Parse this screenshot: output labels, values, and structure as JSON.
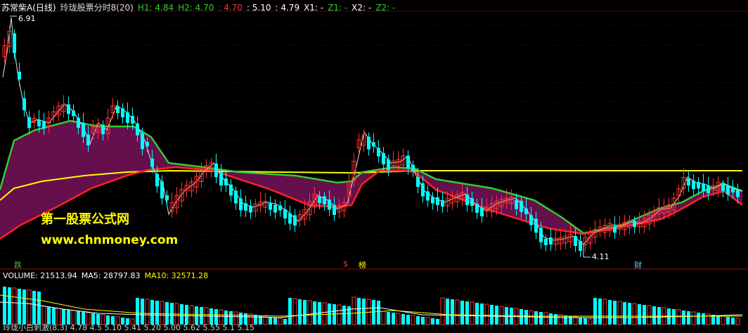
{
  "header": {
    "stock_name": "苏常柴A",
    "period": "(日线)",
    "indicator": "玲珑股票分时8(20)",
    "h1": "H1: 4.84",
    "h2": "H2: 4.70",
    "v3": ": 4.70",
    "v4": ": 5.10",
    "v5": ": 4.79",
    "x1": "X1: -",
    "z1": "Z1: -",
    "x2": "X2: -",
    "z2": "Z2: -"
  },
  "price_panel": {
    "high_label": "6.91",
    "low_label": "4.11",
    "signals": [
      {
        "text": "跌",
        "color": "#33cc33"
      },
      {
        "text": "$",
        "color": "#ff3333"
      },
      {
        "text": "榜",
        "color": "#ffff00"
      },
      {
        "text": "财",
        "color": "#66ccff"
      }
    ]
  },
  "volume_header": {
    "volume": "VOLUME: 21513.94",
    "ma5": "MA5: 28797.83",
    "ma10": "MA10: 32571.28"
  },
  "watermark": {
    "line1": "第一股票公式网",
    "line2": "www.chnmoney.com"
  },
  "bottom_partial": "玲珑小白刺激(8,3) 4.78 4.5 5.10 5.41 5.20 5.00 5.62 5.55 5.1 5.15",
  "colors": {
    "up": "#ff3333",
    "down": "#00ffff",
    "green_line": "#33cc33",
    "red_line": "#ff2222",
    "yellow_line": "#ffff00",
    "purple_fill": "#6a1050",
    "green_fill": "#0a7a0a",
    "grid": "#8b0000"
  }
}
